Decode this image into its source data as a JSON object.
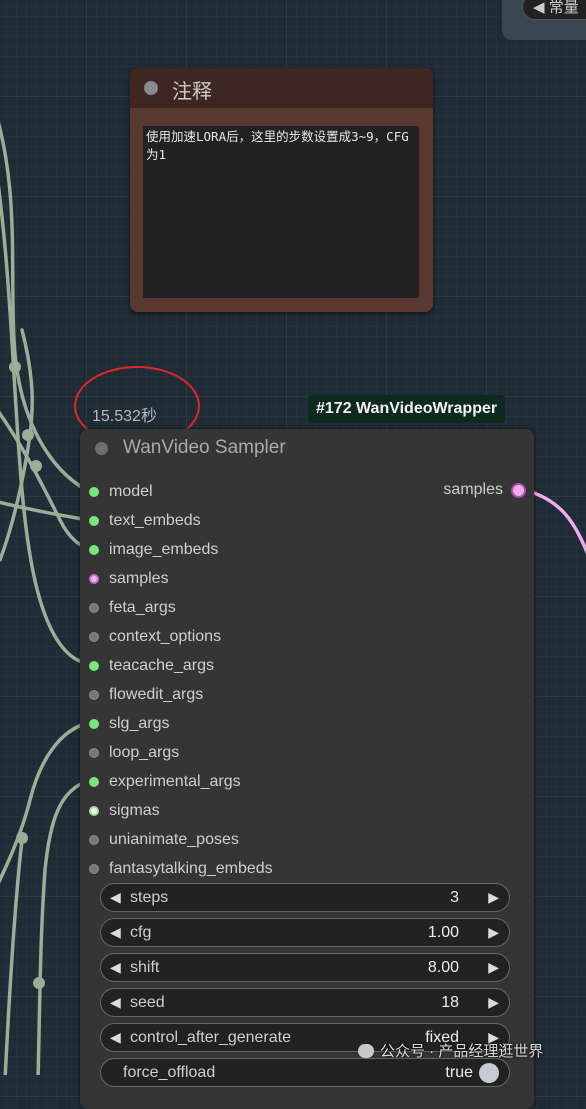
{
  "top_widget": {
    "text": "◀ 常量"
  },
  "note": {
    "title": "注释",
    "text": "使用加速LORA后，这里的步数设置成3~9，CFG为1"
  },
  "timing": "15.532秒",
  "node_badge": "#172 WanVideoWrapper",
  "sampler": {
    "title": "WanVideo Sampler",
    "output": "samples",
    "inputs": [
      {
        "label": "model",
        "slot": "green"
      },
      {
        "label": "text_embeds",
        "slot": "green"
      },
      {
        "label": "image_embeds",
        "slot": "green"
      },
      {
        "label": "samples",
        "slot": "pink"
      },
      {
        "label": "feta_args",
        "slot": "gray"
      },
      {
        "label": "context_options",
        "slot": "gray"
      },
      {
        "label": "teacache_args",
        "slot": "green"
      },
      {
        "label": "flowedit_args",
        "slot": "gray"
      },
      {
        "label": "slg_args",
        "slot": "green"
      },
      {
        "label": "loop_args",
        "slot": "gray"
      },
      {
        "label": "experimental_args",
        "slot": "green"
      },
      {
        "label": "sigmas",
        "slot": "pale"
      },
      {
        "label": "unianimate_poses",
        "slot": "gray"
      },
      {
        "label": "fantasytalking_embeds",
        "slot": "gray"
      }
    ],
    "widgets": [
      {
        "name": "steps",
        "value": "3"
      },
      {
        "name": "cfg",
        "value": "1.00"
      },
      {
        "name": "shift",
        "value": "8.00"
      },
      {
        "name": "seed",
        "value": "18"
      },
      {
        "name": "control_after_generate",
        "value": "fixed"
      },
      {
        "name": "force_offload",
        "value": "true"
      }
    ]
  },
  "watermark": "公众号 · 产品经理逛世界",
  "colors": {
    "green_slot": "#7de67a",
    "pink_slot": "#f3b8f0",
    "wire_sage": "#9aae98",
    "wire_pink": "#f5a8f0",
    "annotation_red": "#e4262b"
  }
}
